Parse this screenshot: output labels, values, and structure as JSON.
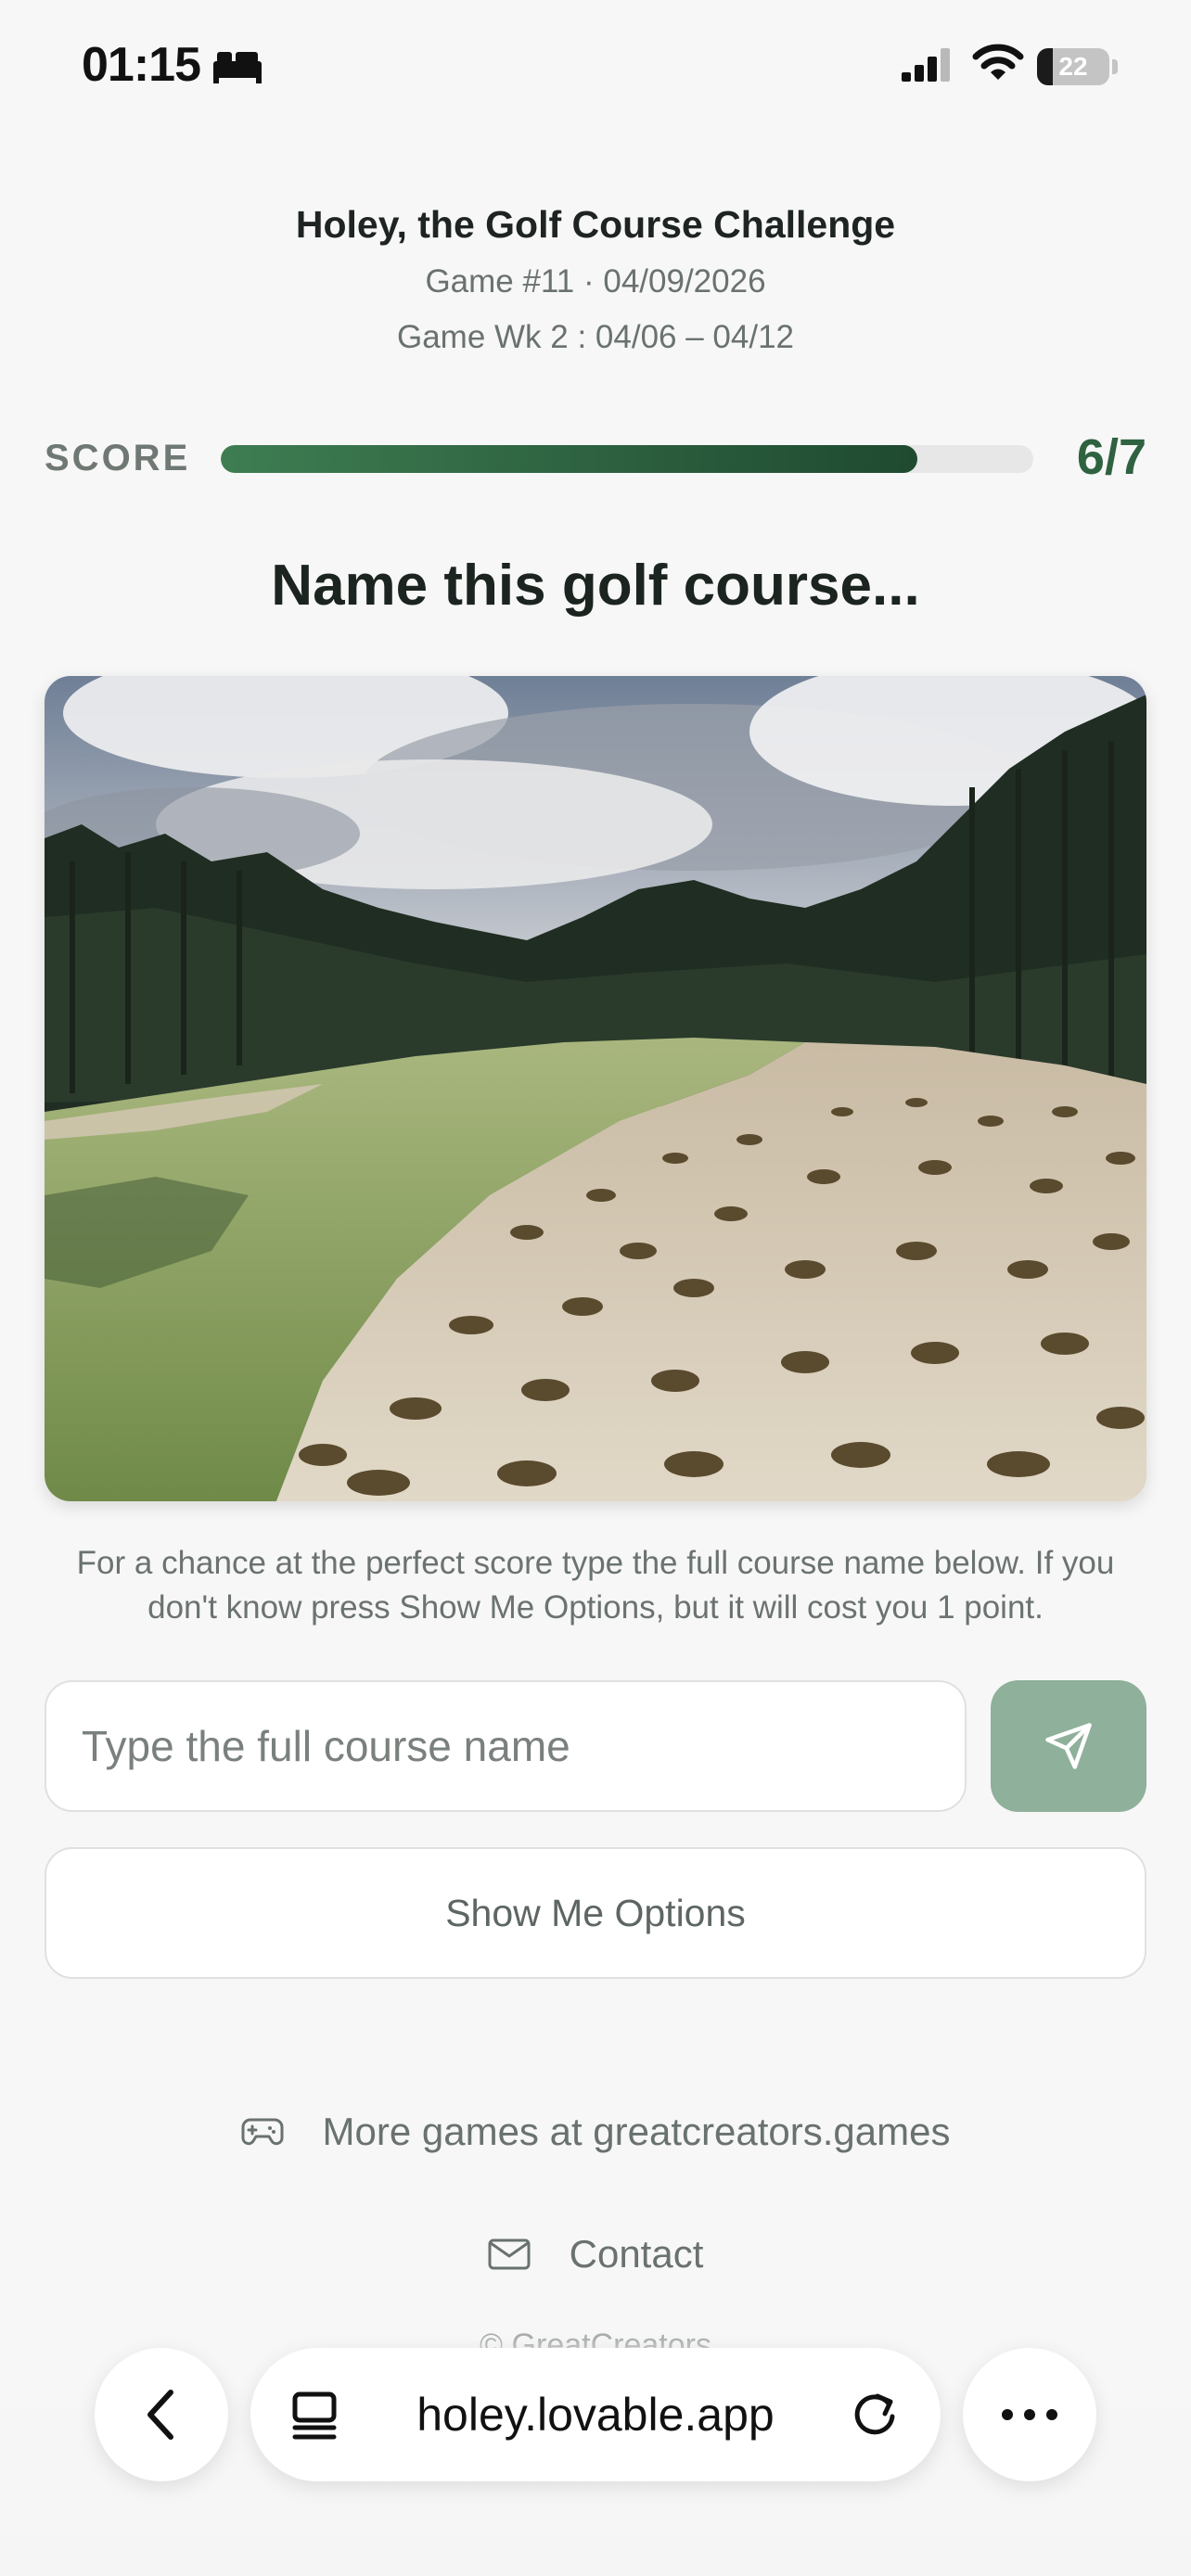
{
  "status_bar": {
    "time": "01:15",
    "battery_level": "22",
    "battery_fraction": 0.22,
    "icons": [
      "bed-icon",
      "cellular-signal-icon",
      "wifi-icon",
      "battery-icon"
    ]
  },
  "header": {
    "title": "Holey, the Golf Course Challenge",
    "game_line": "Game #11 · 04/09/2026",
    "week_line": "Game Wk 2 : 04/06 – 04/12"
  },
  "score": {
    "label": "SCORE",
    "value_text": "6/7",
    "progress_fraction": 0.857
  },
  "question": "Name this golf course...",
  "photo_icon": "golf-course-photo",
  "hint": "For a chance at the perfect score type the full course name below. If you don't know press Show Me Options, but it will cost you 1 point.",
  "answer": {
    "placeholder": "Type the full course name",
    "value": "",
    "submit_icon": "send-icon"
  },
  "options_button": "Show Me Options",
  "footer": {
    "more_games": "More games at greatcreators.games",
    "more_games_icon": "gamepad-icon",
    "contact": "Contact",
    "contact_icon": "mail-icon",
    "copyright": "© GreatCreators"
  },
  "browser": {
    "url": "holey.lovable.app",
    "icons": [
      "back-chevron-icon",
      "tabs-icon",
      "reload-icon",
      "ellipsis-icon"
    ]
  },
  "colors": {
    "accent": "#2f6240",
    "progress": "#2b5c3b",
    "submit": "#8fb09b",
    "background": "#f7f7f7"
  }
}
